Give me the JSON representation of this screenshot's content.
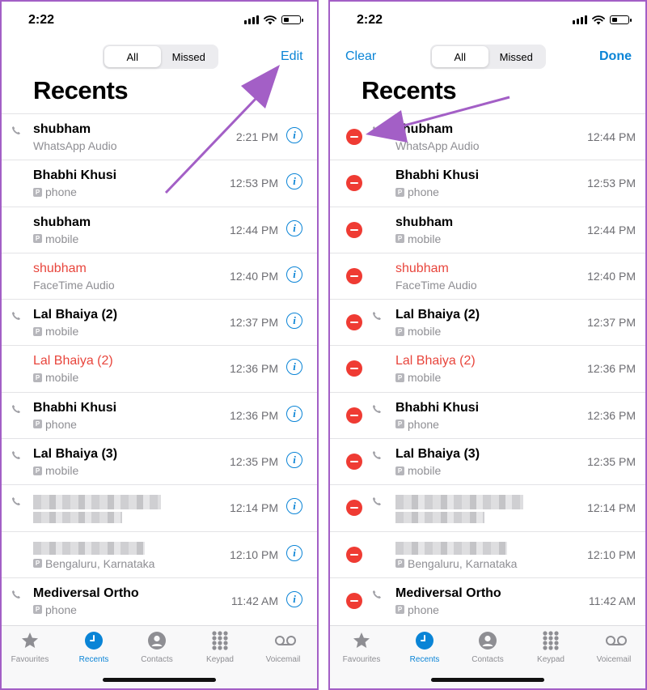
{
  "status": {
    "time": "2:22"
  },
  "segment": {
    "all": "All",
    "missed": "Missed"
  },
  "left": {
    "edit": "Edit"
  },
  "right": {
    "clear": "Clear",
    "done": "Done"
  },
  "title": "Recents",
  "calls": [
    {
      "name": "shubham",
      "sub": "WhatsApp Audio",
      "time": "2:21 PM",
      "right_time": "12:44 PM",
      "missed": false,
      "badge": false,
      "phone_icon": true
    },
    {
      "name": "Bhabhi Khusi",
      "sub": "phone",
      "time": "12:53 PM",
      "right_time": "12:53 PM",
      "missed": false,
      "badge": true,
      "phone_icon": false
    },
    {
      "name": "shubham",
      "sub": "mobile",
      "time": "12:44 PM",
      "right_time": "12:44 PM",
      "missed": false,
      "badge": true,
      "phone_icon": false
    },
    {
      "name": "shubham",
      "sub": "FaceTime Audio",
      "time": "12:40 PM",
      "right_time": "12:40 PM",
      "missed": true,
      "badge": false,
      "phone_icon": false
    },
    {
      "name": "Lal Bhaiya (2)",
      "sub": "mobile",
      "time": "12:37 PM",
      "right_time": "12:37 PM",
      "missed": false,
      "badge": true,
      "phone_icon": true
    },
    {
      "name": "Lal Bhaiya (2)",
      "sub": "mobile",
      "time": "12:36 PM",
      "right_time": "12:36 PM",
      "missed": true,
      "badge": true,
      "phone_icon": false
    },
    {
      "name": "Bhabhi Khusi",
      "sub": "phone",
      "time": "12:36 PM",
      "right_time": "12:36 PM",
      "missed": false,
      "badge": true,
      "phone_icon": true
    },
    {
      "name": "Lal Bhaiya (3)",
      "sub": "mobile",
      "time": "12:35 PM",
      "right_time": "12:35 PM",
      "missed": false,
      "badge": true,
      "phone_icon": true
    },
    {
      "name": "",
      "sub": "",
      "time": "12:14 PM",
      "right_time": "12:14 PM",
      "missed": false,
      "badge": false,
      "phone_icon": true,
      "blurred": "both"
    },
    {
      "name": "",
      "sub": "Bengaluru, Karnataka",
      "time": "12:10 PM",
      "right_time": "12:10 PM",
      "missed": false,
      "badge": true,
      "phone_icon": false,
      "blurred": "name"
    },
    {
      "name": "Mediversal Ortho",
      "sub": "phone",
      "time": "11:42 AM",
      "right_time": "11:42 AM",
      "missed": false,
      "badge": true,
      "phone_icon": true
    }
  ],
  "tabs": [
    {
      "label": "Favourites",
      "icon": "star-icon"
    },
    {
      "label": "Recents",
      "icon": "clock-icon",
      "active": true
    },
    {
      "label": "Contacts",
      "icon": "person-icon"
    },
    {
      "label": "Keypad",
      "icon": "keypad-icon"
    },
    {
      "label": "Voicemail",
      "icon": "voicemail-icon"
    }
  ],
  "colors": {
    "accent": "#0a84d6",
    "missed": "#e8453c",
    "delete": "#ef3b33",
    "annotation": "#a35fc6"
  }
}
